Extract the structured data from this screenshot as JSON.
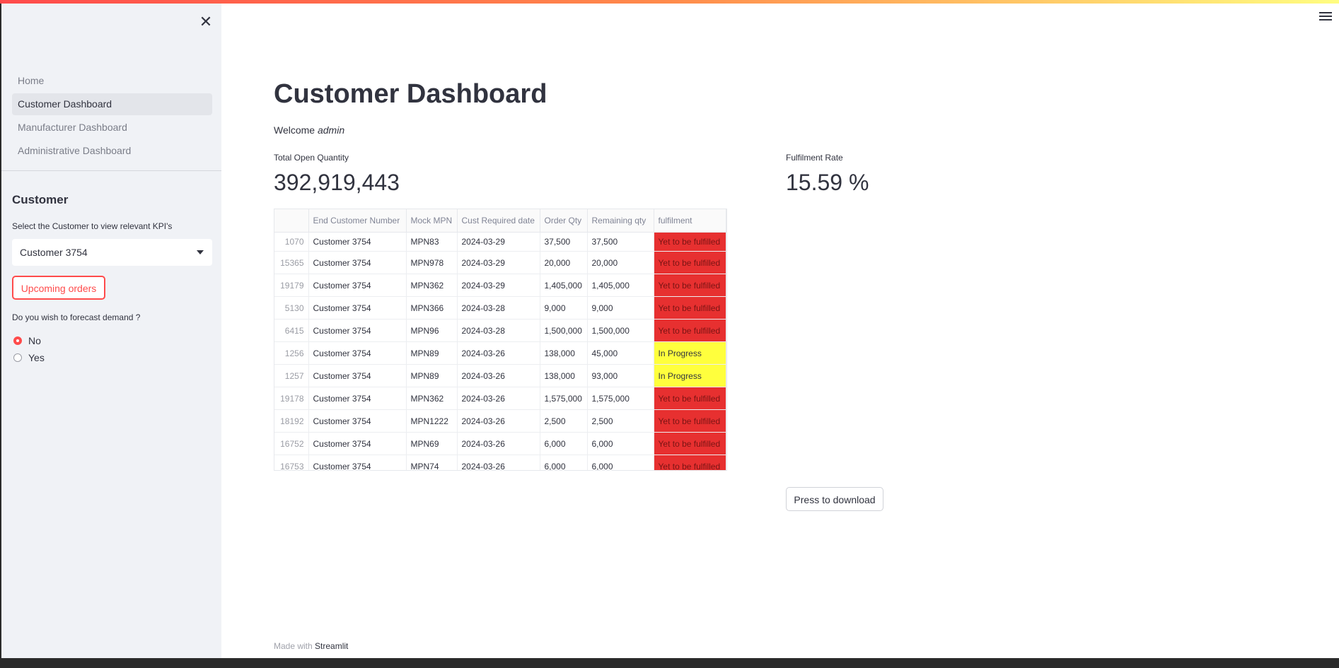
{
  "sidebar": {
    "close_glyph": "✕",
    "nav": [
      "Home",
      "Customer Dashboard",
      "Manufacturer Dashboard",
      "Administrative Dashboard"
    ],
    "section_title": "Customer",
    "select_label": "Select the Customer to view relevant KPI's",
    "select_value": "Customer 3754",
    "upcoming_button": "Upcoming orders",
    "forecast_question": "Do you wish to forecast demand ?",
    "radio_no": "No",
    "radio_yes": "Yes",
    "radio_selected": "No"
  },
  "main": {
    "title": "Customer Dashboard",
    "welcome_prefix": "Welcome ",
    "welcome_user": "admin",
    "metric_open_label": "Total Open Quantity",
    "metric_open_value": "392,919,443",
    "metric_rate_label": "Fulfilment Rate",
    "metric_rate_value": "15.59 %",
    "download_button": "Press to download",
    "footer_prefix": "Made with ",
    "footer_brand": "Streamlit"
  },
  "table": {
    "columns": [
      "",
      "End Customer Number",
      "Mock MPN",
      "Cust Required date",
      "Order Qty",
      "Remaining qty",
      "fulfilment"
    ],
    "rows": [
      {
        "idx": "1070",
        "customer": "Customer 3754",
        "mpn": "MPN83",
        "date": "2024-03-29",
        "order": "37,500",
        "remaining": "37,500",
        "status": "Yet to be fulfilled",
        "color": "red"
      },
      {
        "idx": "15365",
        "customer": "Customer 3754",
        "mpn": "MPN978",
        "date": "2024-03-29",
        "order": "20,000",
        "remaining": "20,000",
        "status": "Yet to be fulfilled",
        "color": "red"
      },
      {
        "idx": "19179",
        "customer": "Customer 3754",
        "mpn": "MPN362",
        "date": "2024-03-29",
        "order": "1,405,000",
        "remaining": "1,405,000",
        "status": "Yet to be fulfilled",
        "color": "red"
      },
      {
        "idx": "5130",
        "customer": "Customer 3754",
        "mpn": "MPN366",
        "date": "2024-03-28",
        "order": "9,000",
        "remaining": "9,000",
        "status": "Yet to be fulfilled",
        "color": "red"
      },
      {
        "idx": "6415",
        "customer": "Customer 3754",
        "mpn": "MPN96",
        "date": "2024-03-28",
        "order": "1,500,000",
        "remaining": "1,500,000",
        "status": "Yet to be fulfilled",
        "color": "red"
      },
      {
        "idx": "1256",
        "customer": "Customer 3754",
        "mpn": "MPN89",
        "date": "2024-03-26",
        "order": "138,000",
        "remaining": "45,000",
        "status": "In Progress",
        "color": "yellow"
      },
      {
        "idx": "1257",
        "customer": "Customer 3754",
        "mpn": "MPN89",
        "date": "2024-03-26",
        "order": "138,000",
        "remaining": "93,000",
        "status": "In Progress",
        "color": "yellow"
      },
      {
        "idx": "19178",
        "customer": "Customer 3754",
        "mpn": "MPN362",
        "date": "2024-03-26",
        "order": "1,575,000",
        "remaining": "1,575,000",
        "status": "Yet to be fulfilled",
        "color": "red"
      },
      {
        "idx": "18192",
        "customer": "Customer 3754",
        "mpn": "MPN1222",
        "date": "2024-03-26",
        "order": "2,500",
        "remaining": "2,500",
        "status": "Yet to be fulfilled",
        "color": "red"
      },
      {
        "idx": "16752",
        "customer": "Customer 3754",
        "mpn": "MPN69",
        "date": "2024-03-26",
        "order": "6,000",
        "remaining": "6,000",
        "status": "Yet to be fulfilled",
        "color": "red"
      },
      {
        "idx": "16753",
        "customer": "Customer 3754",
        "mpn": "MPN74",
        "date": "2024-03-26",
        "order": "6,000",
        "remaining": "6,000",
        "status": "Yet to be fulfilled",
        "color": "red"
      }
    ]
  },
  "colors": {
    "accent": "#ff4b4b",
    "status_red": "#e73030",
    "status_yellow": "#ffff3d",
    "sidebar_bg": "#f0f2f6"
  },
  "icons": [
    "close-icon",
    "menu-icon",
    "chevron-down-icon"
  ]
}
